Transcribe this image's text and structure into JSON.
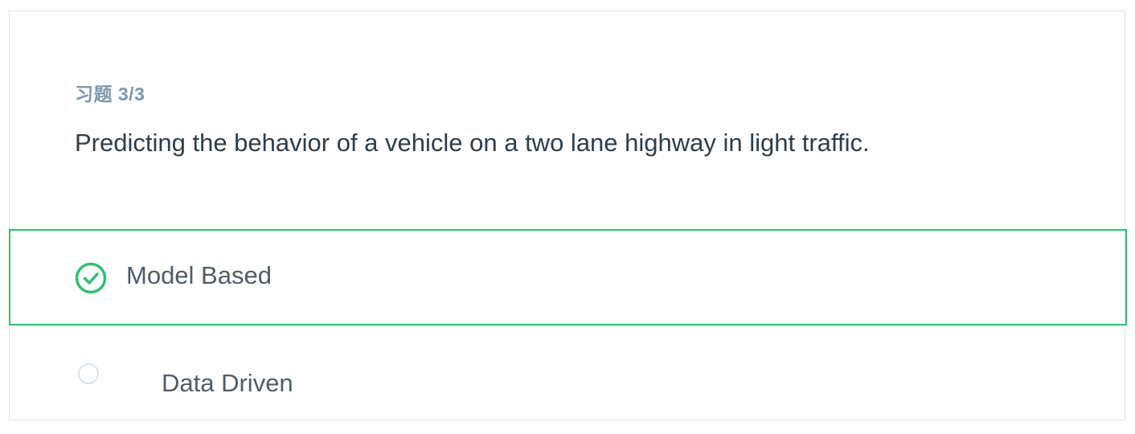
{
  "exercise": {
    "label": "习题 3/3",
    "question": "Predicting the behavior of a vehicle on a two lane highway in light traffic."
  },
  "options": [
    {
      "label": "Model Based",
      "state": "selected-correct"
    },
    {
      "label": "Data Driven",
      "state": "unselected"
    }
  ],
  "colors": {
    "correct": "#2fbf71",
    "label": "#7d97ad",
    "text": "#2e3d49",
    "border": "#dbe2e8"
  },
  "icons": {
    "selected": "check-circle-icon",
    "unselected": "radio-empty-icon"
  }
}
